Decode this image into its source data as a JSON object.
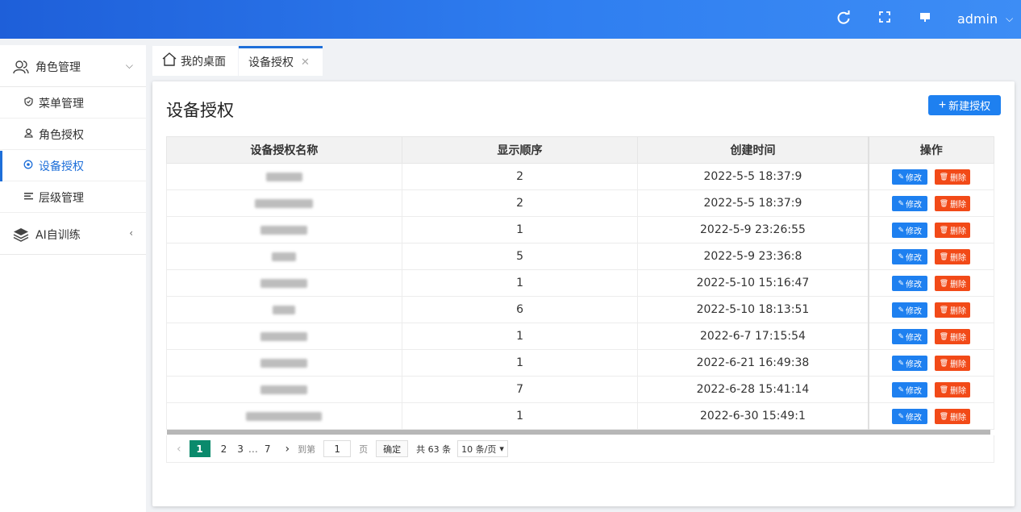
{
  "header": {
    "user": "admin",
    "icons": [
      "refresh-icon",
      "fullscreen-icon",
      "monitor-icon"
    ]
  },
  "sidebar": {
    "groups": [
      {
        "label": "角色管理",
        "icon": "user-group-icon",
        "expanded": true
      },
      {
        "label": "AI自训练",
        "icon": "layers-icon",
        "expanded": false
      }
    ],
    "items": [
      {
        "label": "菜单管理",
        "icon": "shield-check-icon",
        "active": false
      },
      {
        "label": "角色授权",
        "icon": "user-badge-icon",
        "active": false
      },
      {
        "label": "设备授权",
        "icon": "target-icon",
        "active": true
      },
      {
        "label": "层级管理",
        "icon": "list-lines-icon",
        "active": false
      }
    ]
  },
  "tabs": [
    {
      "label": "我的桌面",
      "icon": "home-icon",
      "active": false
    },
    {
      "label": "设备授权",
      "active": true,
      "closable": true
    }
  ],
  "page": {
    "title": "设备授权",
    "new_button": "新建授权"
  },
  "table": {
    "columns": [
      "设备授权名称",
      "显示顺序",
      "创建时间",
      "操作"
    ],
    "rows": [
      {
        "order": "2",
        "created": "2022-5-5 18:37:9"
      },
      {
        "order": "2",
        "created": "2022-5-5 18:37:9"
      },
      {
        "order": "1",
        "created": "2022-5-9 23:26:55"
      },
      {
        "order": "5",
        "created": "2022-5-9 23:36:8"
      },
      {
        "order": "1",
        "created": "2022-5-10 15:16:47"
      },
      {
        "order": "6",
        "created": "2022-5-10 18:13:51"
      },
      {
        "order": "1",
        "created": "2022-6-7 17:15:54"
      },
      {
        "order": "1",
        "created": "2022-6-21 16:49:38"
      },
      {
        "order": "7",
        "created": "2022-6-28 15:41:14"
      },
      {
        "order": "1",
        "created": "2022-6-30 15:49:1"
      }
    ],
    "edit_label": "修改",
    "delete_label": "删除"
  },
  "pagination": {
    "current": "1",
    "pages": [
      "2",
      "3"
    ],
    "ellipsis": "…",
    "last": "7",
    "goto_label": "到第",
    "goto_value": "1",
    "page_unit": "页",
    "confirm": "确定",
    "total": "共 63 条",
    "page_size": "10 条/页"
  },
  "colors": {
    "accent": "#1e80f0",
    "danger": "#f24a18",
    "pager_active": "#0a8a6c"
  }
}
